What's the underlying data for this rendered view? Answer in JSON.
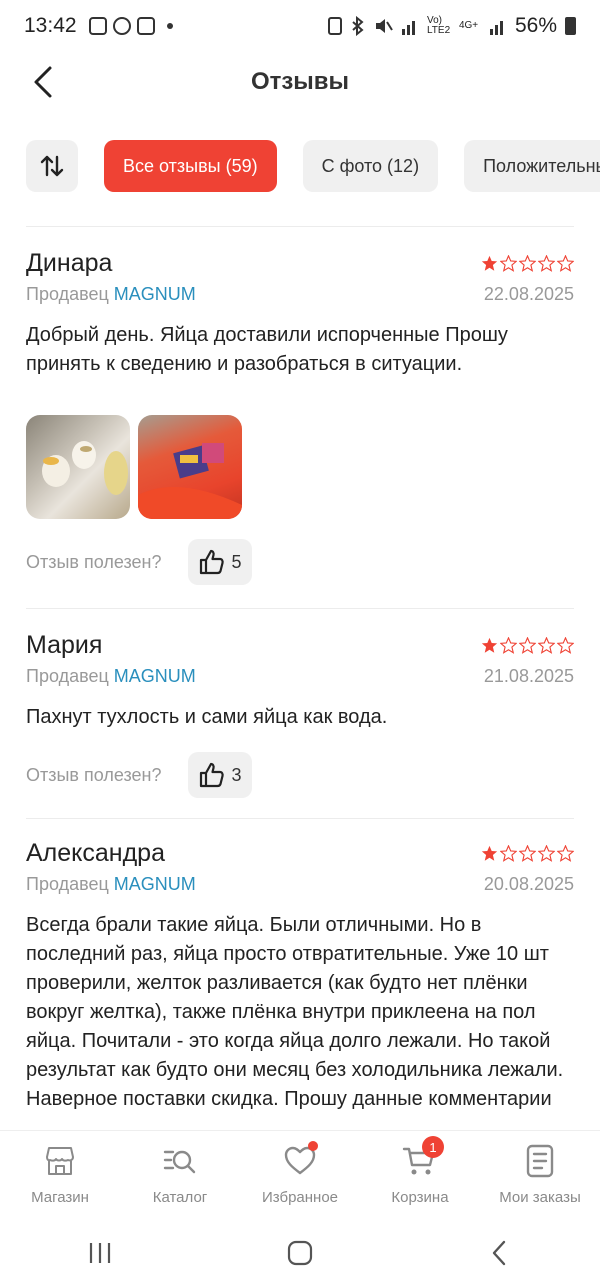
{
  "status_bar": {
    "time": "13:42",
    "battery_percent": "56%",
    "network_label_1": "Vo) LTE2",
    "network_label_2": "4G+"
  },
  "header": {
    "title": "Отзывы"
  },
  "filters": {
    "chips": [
      {
        "label": "Все отзывы (59)",
        "active": true
      },
      {
        "label": "С фото (12)",
        "active": false
      },
      {
        "label": "Положительные",
        "active": false
      }
    ]
  },
  "reviews": [
    {
      "name": "Динара",
      "rating": 1,
      "seller_prefix": "Продавец",
      "seller_name": "MAGNUM",
      "date": "22.08.2025",
      "text": "Добрый день. Яйца доставили испорченные Прошу принять к сведению и разобраться в ситуации.",
      "useful_label": "Отзыв полезен?",
      "likes": "5"
    },
    {
      "name": "Мария",
      "rating": 1,
      "seller_prefix": "Продавец",
      "seller_name": "MAGNUM",
      "date": "21.08.2025",
      "text": "Пахнут тухлость и сами яйца как вода.",
      "useful_label": "Отзыв полезен?",
      "likes": "3"
    },
    {
      "name": "Александра",
      "rating": 1,
      "seller_prefix": "Продавец",
      "seller_name": "MAGNUM",
      "date": "20.08.2025",
      "text": "Всегда брали такие яйца. Были отличными. Но в последний раз, яйца просто отвратительные. Уже 10 шт проверили, желток разливается (как будто нет плёнки вокруг желтка), также плёнка внутри приклеена на пол яйца. Почитали - это когда яйца долго лежали. Но такой результат как будто они месяц без холодильника лежали. Наверное поставки скидка. Прошу данные комментарии"
    }
  ],
  "bottom_nav": [
    {
      "label": "Магазин",
      "icon": "store-icon"
    },
    {
      "label": "Каталог",
      "icon": "catalog-search-icon"
    },
    {
      "label": "Избранное",
      "icon": "heart-icon",
      "dot": true
    },
    {
      "label": "Корзина",
      "icon": "cart-icon",
      "badge": "1"
    },
    {
      "label": "Мои заказы",
      "icon": "orders-icon"
    }
  ],
  "colors": {
    "accent": "#ef4234",
    "seller_link": "#2a8fbd",
    "muted_text": "#999999",
    "chip_bg": "#f0f0f0"
  }
}
